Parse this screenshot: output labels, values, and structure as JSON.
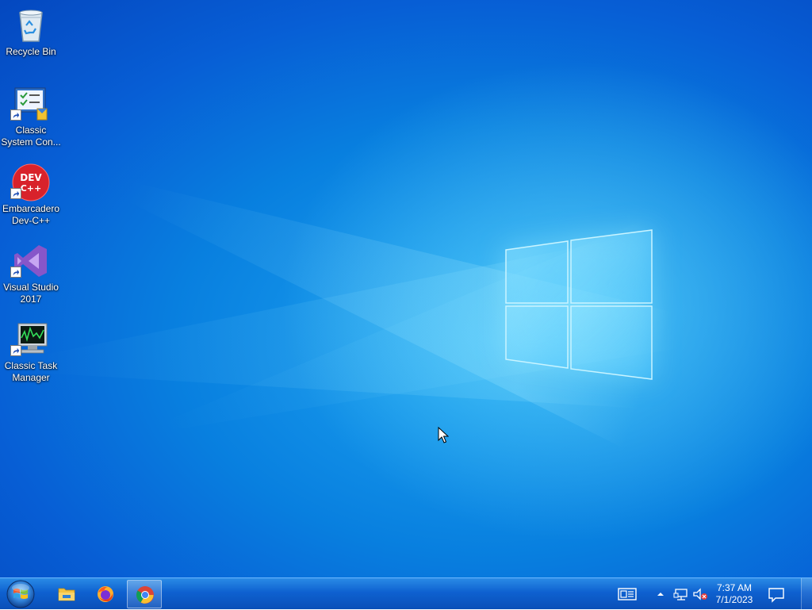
{
  "desktop": {
    "icons": [
      {
        "name": "recycle-bin",
        "label": "Recycle Bin",
        "shortcut": false
      },
      {
        "name": "classic-system-control",
        "label": "Classic\nSystem Con...",
        "shortcut": true
      },
      {
        "name": "embarcadero-dev-cpp",
        "label": "Embarcadero\nDev-C++",
        "shortcut": true,
        "icon_text": "DEV C++"
      },
      {
        "name": "visual-studio-2017",
        "label": "Visual Studio\n2017",
        "shortcut": true
      },
      {
        "name": "classic-task-manager",
        "label": "Classic Task\nManager",
        "shortcut": true
      }
    ]
  },
  "taskbar": {
    "pinned": [
      {
        "name": "file-explorer",
        "icon": "folder-icon",
        "active": false
      },
      {
        "name": "firefox",
        "icon": "firefox-icon",
        "active": false
      },
      {
        "name": "chrome",
        "icon": "chrome-icon",
        "active": true
      }
    ],
    "tray": {
      "icons": [
        "news-icon",
        "chevron-up-icon",
        "network-icon",
        "volume-muted-icon"
      ],
      "time": "7:37 AM",
      "date": "7/1/2023",
      "notification_icon": "action-center-icon"
    }
  },
  "colors": {
    "taskbar_top": "#2a8be6",
    "taskbar_bottom": "#0a4fb8",
    "desktop_dark": "#0447bf",
    "desktop_light": "#1ea6f2"
  }
}
